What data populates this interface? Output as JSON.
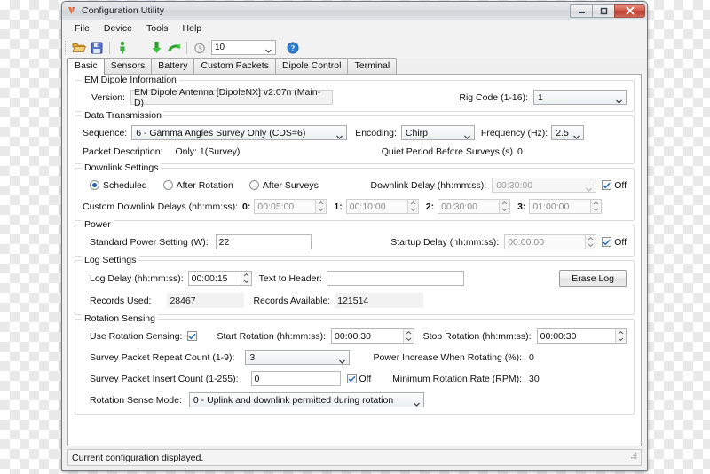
{
  "window": {
    "title": "Configuration Utility",
    "logo_icon": "v-logo-icon",
    "controls": {
      "minimize": "minimize-icon",
      "maximize": "maximize-icon",
      "close": "close-icon"
    }
  },
  "menu": [
    {
      "label": "File"
    },
    {
      "label": "Device"
    },
    {
      "label": "Tools"
    },
    {
      "label": "Help"
    }
  ],
  "toolbar": {
    "buttons": [
      {
        "icon": "open-folder-icon"
      },
      {
        "icon": "save-disk-icon"
      },
      {
        "icon": "upload-person-icon"
      },
      {
        "icon": "download-arrow-icon"
      },
      {
        "icon": "upload-arrow-icon"
      },
      {
        "icon": "clock-refresh-icon"
      },
      {
        "icon": "help-icon"
      }
    ],
    "interval_value": "10",
    "dropdown_arrow": "chevron-down-icon"
  },
  "tabs": [
    {
      "label": "Basic",
      "active": true
    },
    {
      "label": "Sensors",
      "active": false
    },
    {
      "label": "Battery",
      "active": false
    },
    {
      "label": "Custom Packets",
      "active": false
    },
    {
      "label": "Dipole Control",
      "active": false
    },
    {
      "label": "Terminal",
      "active": false
    }
  ],
  "em_dipole": {
    "legend": "EM Dipole Information",
    "version_label": "Version:",
    "version_value": "EM Dipole Antenna [DipoleNX] v2.07n (Main-D)",
    "rig_code_label": "Rig Code (1-16):",
    "rig_code_value": "1"
  },
  "data_transmission": {
    "legend": "Data Transmission",
    "sequence_label": "Sequence:",
    "sequence_value": "6 - Gamma Angles Survey Only (CDS=6)",
    "encoding_label": "Encoding:",
    "encoding_value": "Chirp",
    "frequency_label": "Frequency (Hz):",
    "frequency_value": "2.5",
    "packet_description_label": "Packet Description:",
    "packet_description_value": "Only: 1(Survey)",
    "quiet_period_label": "Quiet Period Before Surveys (s)",
    "quiet_period_value": "0"
  },
  "downlink": {
    "legend": "Downlink Settings",
    "mode_scheduled": "Scheduled",
    "mode_after_rotation": "After Rotation",
    "mode_after_surveys": "After Surveys",
    "selected_mode": "Scheduled",
    "delay_label": "Downlink Delay (hh:mm:ss):",
    "delay_value": "00:30:00",
    "delay_off_label": "Off",
    "delay_off_checked": true,
    "custom_label": "Custom Downlink Delays (hh:mm:ss):",
    "custom": [
      {
        "index": "0:",
        "value": "00:05:00"
      },
      {
        "index": "1:",
        "value": "00:10:00"
      },
      {
        "index": "2:",
        "value": "00:30:00"
      },
      {
        "index": "3:",
        "value": "01:00:00"
      }
    ]
  },
  "power": {
    "legend": "Power",
    "standard_label": "Standard Power Setting (W):",
    "standard_value": "22",
    "startup_label": "Startup Delay (hh:mm:ss):",
    "startup_value": "00:00:00",
    "startup_off_label": "Off",
    "startup_off_checked": true
  },
  "log": {
    "legend": "Log Settings",
    "delay_label": "Log Delay (hh:mm:ss):",
    "delay_value": "00:00:15",
    "header_label": "Text to Header:",
    "header_value": "",
    "erase_button": "Erase Log",
    "records_used_label": "Records Used:",
    "records_used_value": "28467",
    "records_available_label": "Records Available:",
    "records_available_value": "121514"
  },
  "rotation": {
    "legend": "Rotation Sensing",
    "use_label": "Use Rotation Sensing:",
    "use_checked": true,
    "start_label": "Start Rotation (hh:mm:ss):",
    "start_value": "00:00:30",
    "stop_label": "Stop Rotation (hh:mm:ss):",
    "stop_value": "00:00:30",
    "repeat_label": "Survey Packet Repeat Count (1-9):",
    "repeat_value": "3",
    "power_increase_label": "Power Increase When Rotating (%):",
    "power_increase_value": "0",
    "insert_label": "Survey Packet Insert Count (1-255):",
    "insert_value": "0",
    "insert_off_label": "Off",
    "insert_off_checked": true,
    "min_rate_label": "Minimum Rotation Rate (RPM):",
    "min_rate_value": "30",
    "mode_label": "Rotation Sense Mode:",
    "mode_value": "0 - Uplink and downlink permitted during rotation"
  },
  "statusbar": {
    "message": "Current configuration displayed.",
    "gripper_icon": "resize-gripper-icon"
  }
}
